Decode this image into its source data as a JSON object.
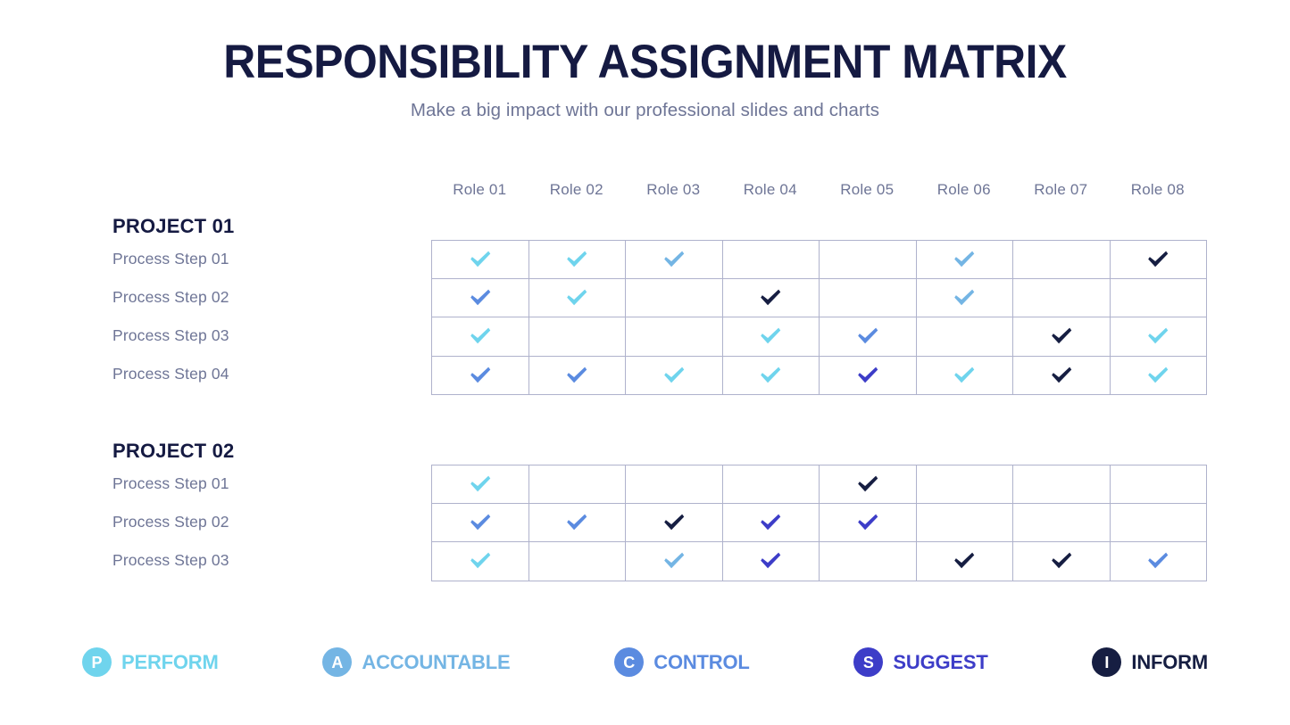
{
  "header": {
    "title": "RESPONSIBILITY ASSIGNMENT MATRIX",
    "subtitle": "Make a big impact with our professional slides and charts"
  },
  "columns": [
    "Role 01",
    "Role 02",
    "Role 03",
    "Role 04",
    "Role 05",
    "Role 06",
    "Role 07",
    "Role 08"
  ],
  "colors": {
    "perform": "#6FD4ED",
    "accountable": "#74B5E4",
    "control": "#5B8BE0",
    "suggest": "#3D3DC8",
    "inform": "#161E42",
    "title": "#151A42",
    "muted": "#6E7596",
    "border": "#AFB2CC"
  },
  "groups": [
    {
      "title": "PROJECT 01",
      "rows": [
        {
          "label": "Process Step 01",
          "cells": [
            "perform",
            "perform",
            "accountable",
            "",
            "",
            "accountable",
            "",
            "inform"
          ]
        },
        {
          "label": "Process Step 02",
          "cells": [
            "control",
            "perform",
            "",
            "inform",
            "",
            "accountable",
            "",
            ""
          ]
        },
        {
          "label": "Process Step 03",
          "cells": [
            "perform",
            "",
            "",
            "perform",
            "control",
            "",
            "inform",
            "perform"
          ]
        },
        {
          "label": "Process Step 04",
          "cells": [
            "control",
            "control",
            "perform",
            "perform",
            "suggest",
            "perform",
            "inform",
            "perform"
          ]
        }
      ]
    },
    {
      "title": "PROJECT 02",
      "rows": [
        {
          "label": "Process Step 01",
          "cells": [
            "perform",
            "",
            "",
            "",
            "inform",
            "",
            "",
            ""
          ]
        },
        {
          "label": "Process Step 02",
          "cells": [
            "control",
            "control",
            "inform",
            "suggest",
            "suggest",
            "",
            "",
            ""
          ]
        },
        {
          "label": "Process Step 03",
          "cells": [
            "perform",
            "",
            "accountable",
            "suggest",
            "",
            "inform",
            "inform",
            "control"
          ]
        }
      ]
    }
  ],
  "legend": [
    {
      "key": "perform",
      "badge": "P",
      "label": "PERFORM",
      "color": "#6FD4ED"
    },
    {
      "key": "accountable",
      "badge": "A",
      "label": "ACCOUNTABLE",
      "color": "#74B5E4"
    },
    {
      "key": "control",
      "badge": "C",
      "label": "CONTROL",
      "color": "#5B8BE0"
    },
    {
      "key": "suggest",
      "badge": "S",
      "label": "SUGGEST",
      "color": "#3D3DC8"
    },
    {
      "key": "inform",
      "badge": "I",
      "label": "INFORM",
      "color": "#161E42"
    }
  ]
}
